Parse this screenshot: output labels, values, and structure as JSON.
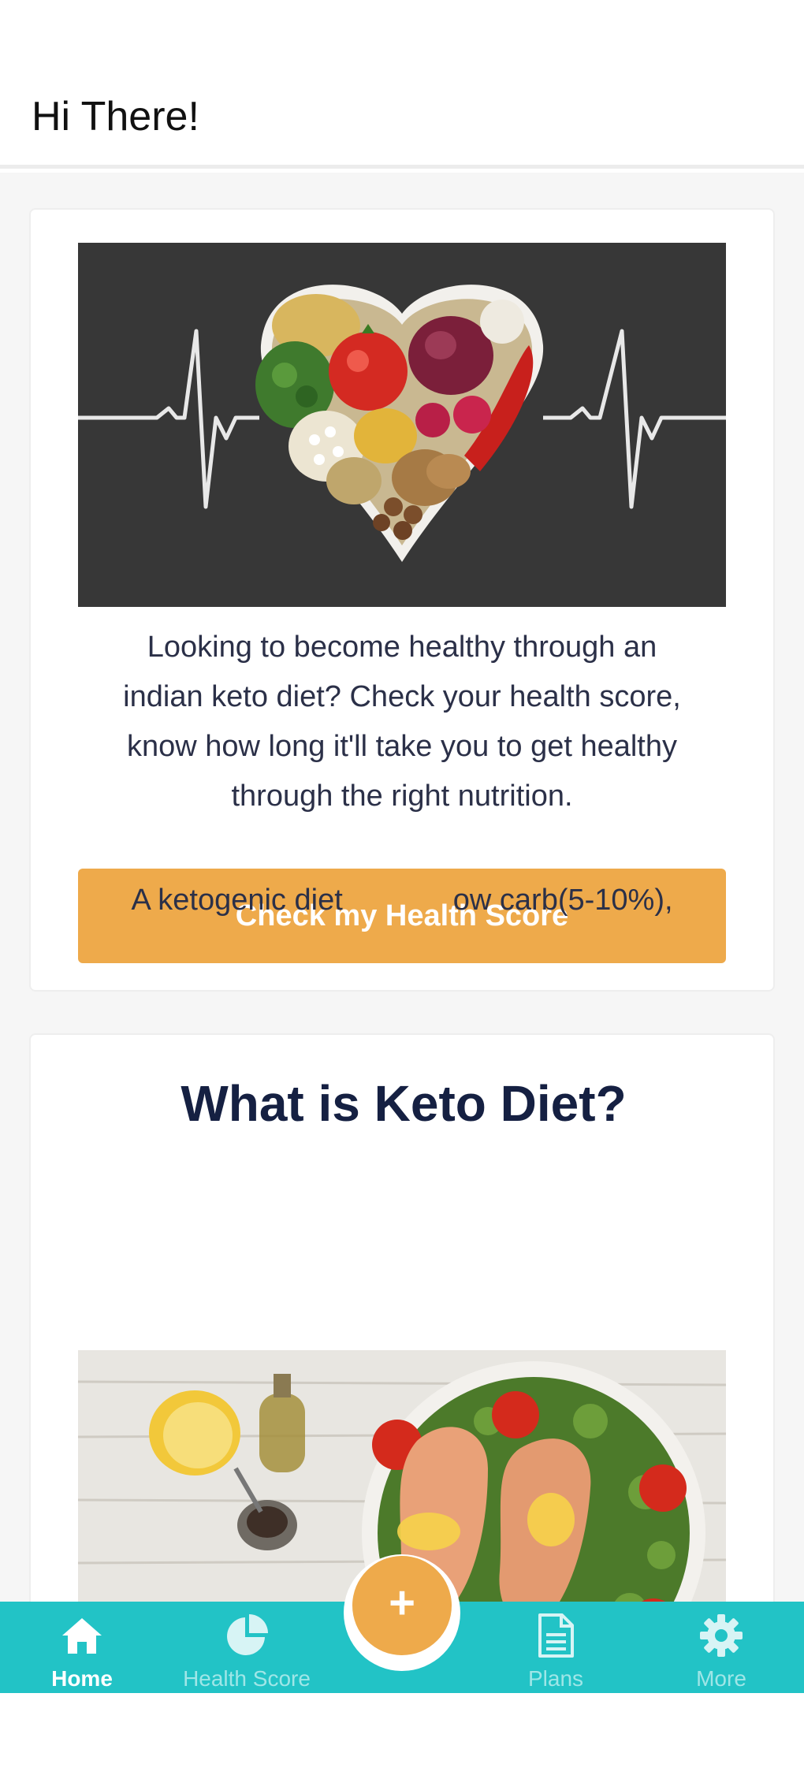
{
  "header": {
    "greeting": "Hi There!"
  },
  "health_card": {
    "image_icon": "heart-vegetables-image",
    "description": "Looking to become healthy through an indian keto diet? Check your health score, know how long it'll take you to get healthy through the right nutrition.",
    "description_lines": [
      "Looking to become healthy through an",
      "indian keto diet? Check your health score,",
      "know how long it'll take you to get healthy",
      "through the right nutrition."
    ],
    "cta_label": "Check my Health Score"
  },
  "keto_card": {
    "title": "What is Keto Diet?",
    "image_icon": "salmon-vegetables-image",
    "teaser_visible": "A ketogenic diet",
    "teaser_tail": "ow carb(5-10%),"
  },
  "fab": {
    "symbol": "+",
    "icon": "plus-icon"
  },
  "bottom_nav": {
    "items": [
      {
        "label": "Home",
        "icon": "home-icon",
        "active": true
      },
      {
        "label": "Health Score",
        "icon": "pie-chart-icon",
        "active": false
      },
      {
        "label": "Plans",
        "icon": "document-icon",
        "active": false
      },
      {
        "label": "More",
        "icon": "gear-icon",
        "active": false
      }
    ]
  },
  "colors": {
    "accent": "#eeaa4b",
    "nav_background": "#22c3c6",
    "title_text": "#152042",
    "nav_inactive_label": "#9fe6e7"
  }
}
